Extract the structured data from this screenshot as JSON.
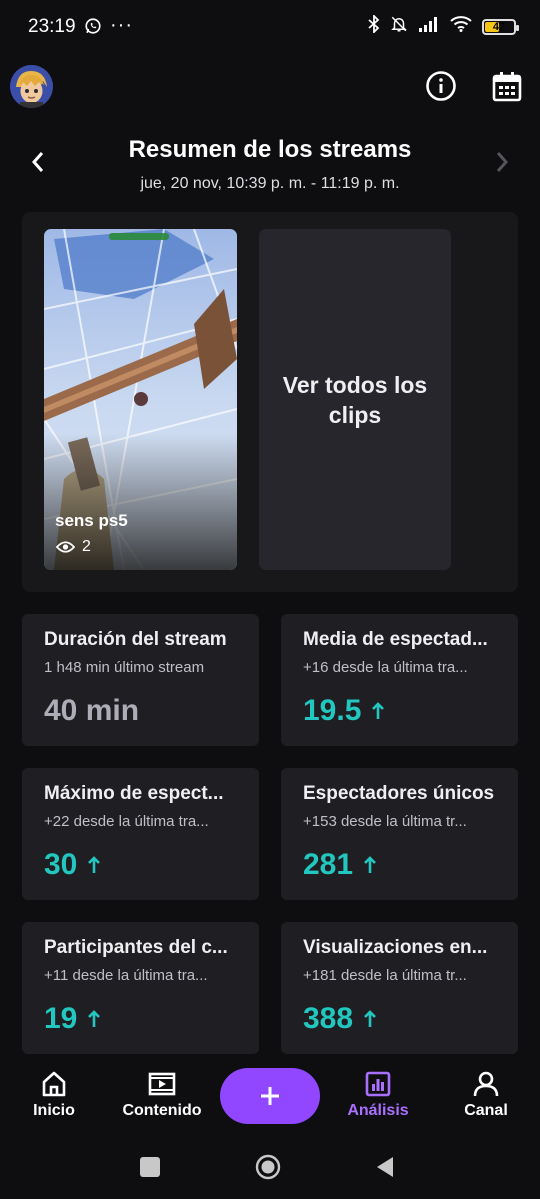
{
  "status_bar": {
    "time": "23:19",
    "battery": "47",
    "battery_level": 0.47
  },
  "header": {
    "title": "Resumen de los streams",
    "subtitle": "jue, 20 nov, 10:39 p. m. - 11:19 p. m."
  },
  "clips": {
    "items": [
      {
        "title": "sens ps5",
        "views": "2"
      }
    ],
    "view_all_label": "Ver todos los clips"
  },
  "stats": [
    {
      "title": "Duración del stream",
      "subtitle": "1 h48 min último stream",
      "value": "40 min",
      "trend": "none"
    },
    {
      "title": "Media de espectad...",
      "subtitle": "+16 desde la última tra...",
      "value": "19.5",
      "trend": "up"
    },
    {
      "title": "Máximo de espect...",
      "subtitle": "+22 desde la última tra...",
      "value": "30",
      "trend": "up"
    },
    {
      "title": "Espectadores únicos",
      "subtitle": "+153 desde la última tr...",
      "value": "281",
      "trend": "up"
    },
    {
      "title": "Participantes del c...",
      "subtitle": "+11 desde la última tra...",
      "value": "19",
      "trend": "up"
    },
    {
      "title": "Visualizaciones en...",
      "subtitle": "+181 desde la última tr...",
      "value": "388",
      "trend": "up"
    }
  ],
  "bottom_nav": {
    "items": [
      {
        "label": "Inicio",
        "icon": "home-icon"
      },
      {
        "label": "Contenido",
        "icon": "video-icon"
      },
      {
        "label": "Análisis",
        "icon": "analytics-icon",
        "active": true
      },
      {
        "label": "Canal",
        "icon": "profile-icon"
      }
    ],
    "add_icon": "plus-icon"
  },
  "colors": {
    "accent": "#9147ff",
    "accent_text": "#a970ff",
    "trend_up": "#22c7c0",
    "card_bg": "#1f1f23"
  }
}
